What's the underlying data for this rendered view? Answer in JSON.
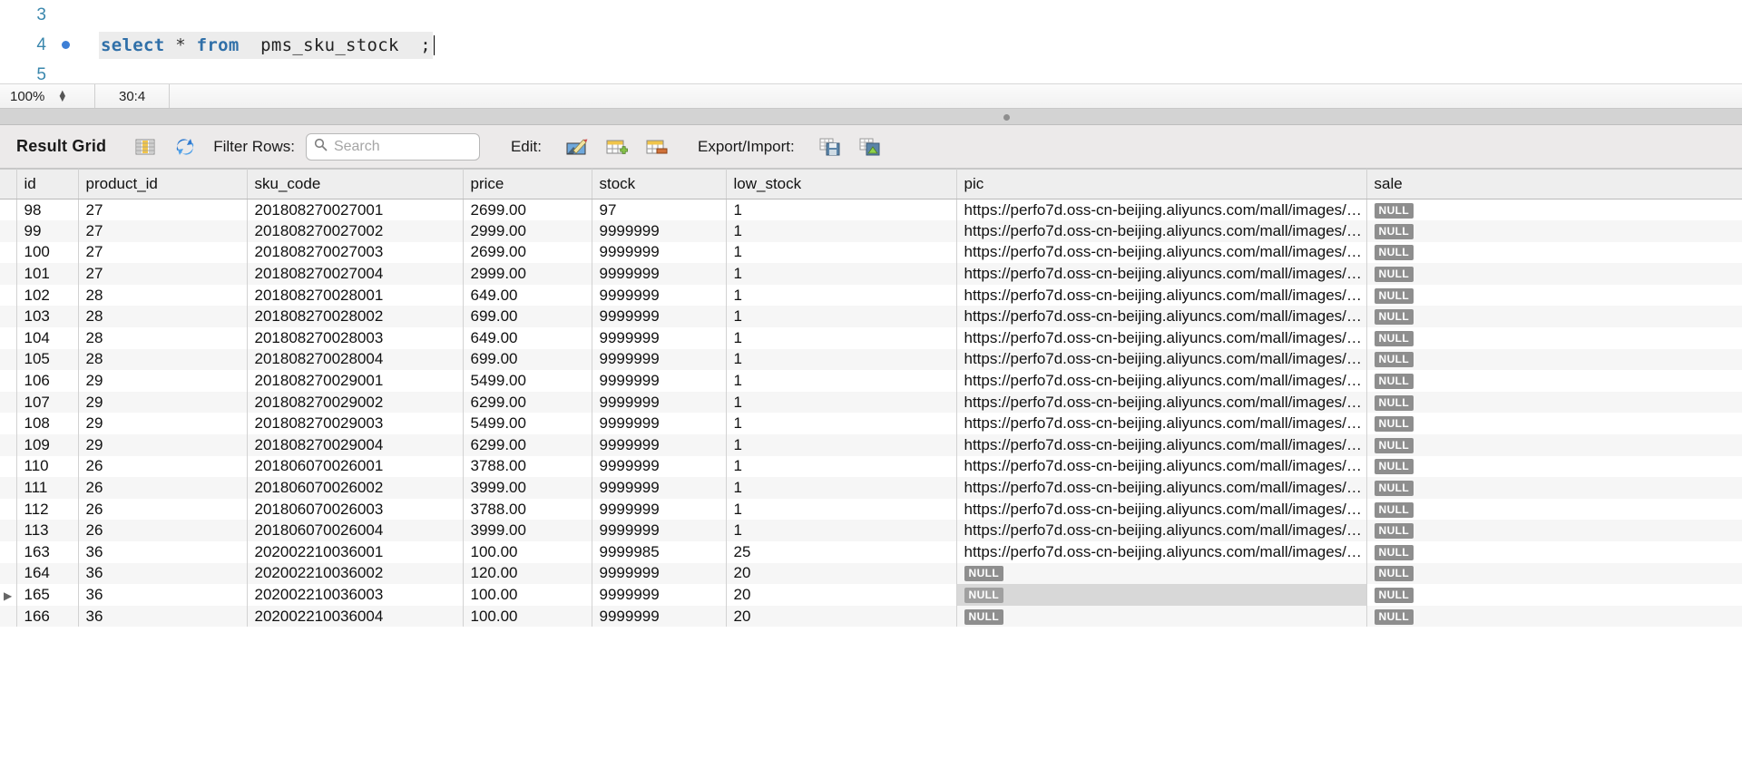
{
  "editor": {
    "lines": [
      {
        "number": "3",
        "breakpoint": false,
        "segments": []
      },
      {
        "number": "4",
        "breakpoint": true,
        "segments": [
          {
            "text": "select",
            "kind": "kw"
          },
          {
            "text": " ",
            "kind": "plain"
          },
          {
            "text": "*",
            "kind": "op"
          },
          {
            "text": " ",
            "kind": "plain"
          },
          {
            "text": "from",
            "kind": "kw"
          },
          {
            "text": " ",
            "kind": "plain"
          },
          {
            "text": "pms_sku_stock",
            "kind": "ident"
          },
          {
            "text": " ",
            "kind": "plain"
          },
          {
            "text": ";",
            "kind": "semi"
          }
        ]
      },
      {
        "number": "5",
        "breakpoint": false,
        "segments": []
      }
    ],
    "statement_text": "select * from pms_sku_stock ;"
  },
  "statusbar": {
    "zoom": "100%",
    "stepper_up": "▲",
    "stepper_down": "▼",
    "cursor_position": "30:4"
  },
  "result_toolbar": {
    "title": "Result Grid",
    "grid_icon": "grid-columns-icon",
    "refresh_icon": "refresh-icon",
    "filter_label": "Filter Rows:",
    "search_placeholder": "Search",
    "search_value": "",
    "search_icon": "search-icon",
    "edit_label": "Edit:",
    "edit_icons": [
      "edit-pencil-icon",
      "insert-row-icon",
      "delete-row-icon"
    ],
    "export_label": "Export/Import:",
    "export_icons": [
      "export-save-icon",
      "import-icon"
    ]
  },
  "grid": {
    "columns": [
      "id",
      "product_id",
      "sku_code",
      "price",
      "stock",
      "low_stock",
      "pic",
      "sale"
    ],
    "pic_url_truncated": "https://perfo7d.oss-cn-beijing.aliyuncs.com/mall/images/…",
    "null_label": "NULL",
    "current_row_marker": "▶",
    "current_row_id": "165",
    "rows": [
      {
        "id": "98",
        "product_id": "27",
        "sku_code": "201808270027001",
        "price": "2699.00",
        "stock": "97",
        "low_stock": "1",
        "pic": "url",
        "sale": "NULL"
      },
      {
        "id": "99",
        "product_id": "27",
        "sku_code": "201808270027002",
        "price": "2999.00",
        "stock": "9999999",
        "low_stock": "1",
        "pic": "url",
        "sale": "NULL"
      },
      {
        "id": "100",
        "product_id": "27",
        "sku_code": "201808270027003",
        "price": "2699.00",
        "stock": "9999999",
        "low_stock": "1",
        "pic": "url",
        "sale": "NULL"
      },
      {
        "id": "101",
        "product_id": "27",
        "sku_code": "201808270027004",
        "price": "2999.00",
        "stock": "9999999",
        "low_stock": "1",
        "pic": "url",
        "sale": "NULL"
      },
      {
        "id": "102",
        "product_id": "28",
        "sku_code": "201808270028001",
        "price": "649.00",
        "stock": "9999999",
        "low_stock": "1",
        "pic": "url",
        "sale": "NULL"
      },
      {
        "id": "103",
        "product_id": "28",
        "sku_code": "201808270028002",
        "price": "699.00",
        "stock": "9999999",
        "low_stock": "1",
        "pic": "url",
        "sale": "NULL"
      },
      {
        "id": "104",
        "product_id": "28",
        "sku_code": "201808270028003",
        "price": "649.00",
        "stock": "9999999",
        "low_stock": "1",
        "pic": "url",
        "sale": "NULL"
      },
      {
        "id": "105",
        "product_id": "28",
        "sku_code": "201808270028004",
        "price": "699.00",
        "stock": "9999999",
        "low_stock": "1",
        "pic": "url",
        "sale": "NULL"
      },
      {
        "id": "106",
        "product_id": "29",
        "sku_code": "201808270029001",
        "price": "5499.00",
        "stock": "9999999",
        "low_stock": "1",
        "pic": "url",
        "sale": "NULL"
      },
      {
        "id": "107",
        "product_id": "29",
        "sku_code": "201808270029002",
        "price": "6299.00",
        "stock": "9999999",
        "low_stock": "1",
        "pic": "url",
        "sale": "NULL"
      },
      {
        "id": "108",
        "product_id": "29",
        "sku_code": "201808270029003",
        "price": "5499.00",
        "stock": "9999999",
        "low_stock": "1",
        "pic": "url",
        "sale": "NULL"
      },
      {
        "id": "109",
        "product_id": "29",
        "sku_code": "201808270029004",
        "price": "6299.00",
        "stock": "9999999",
        "low_stock": "1",
        "pic": "url",
        "sale": "NULL"
      },
      {
        "id": "110",
        "product_id": "26",
        "sku_code": "201806070026001",
        "price": "3788.00",
        "stock": "9999999",
        "low_stock": "1",
        "pic": "url",
        "sale": "NULL"
      },
      {
        "id": "111",
        "product_id": "26",
        "sku_code": "201806070026002",
        "price": "3999.00",
        "stock": "9999999",
        "low_stock": "1",
        "pic": "url",
        "sale": "NULL"
      },
      {
        "id": "112",
        "product_id": "26",
        "sku_code": "201806070026003",
        "price": "3788.00",
        "stock": "9999999",
        "low_stock": "1",
        "pic": "url",
        "sale": "NULL"
      },
      {
        "id": "113",
        "product_id": "26",
        "sku_code": "201806070026004",
        "price": "3999.00",
        "stock": "9999999",
        "low_stock": "1",
        "pic": "url",
        "sale": "NULL"
      },
      {
        "id": "163",
        "product_id": "36",
        "sku_code": "202002210036001",
        "price": "100.00",
        "stock": "9999985",
        "low_stock": "25",
        "pic": "url",
        "sale": "NULL"
      },
      {
        "id": "164",
        "product_id": "36",
        "sku_code": "202002210036002",
        "price": "120.00",
        "stock": "9999999",
        "low_stock": "20",
        "pic": "NULL",
        "sale": "NULL"
      },
      {
        "id": "165",
        "product_id": "36",
        "sku_code": "202002210036003",
        "price": "100.00",
        "stock": "9999999",
        "low_stock": "20",
        "pic": "NULL",
        "sale": "NULL"
      },
      {
        "id": "166",
        "product_id": "36",
        "sku_code": "202002210036004",
        "price": "100.00",
        "stock": "9999999",
        "low_stock": "20",
        "pic": "NULL",
        "sale": "NULL"
      }
    ]
  },
  "colors": {
    "keyword": "#2f6fa8",
    "line_number": "#3a87ad",
    "breakpoint": "#3d7fd6",
    "null_badge": "#8e8e8e",
    "toolbar_bg": "#eceaea",
    "splitter_bg": "#d3d3d3"
  }
}
